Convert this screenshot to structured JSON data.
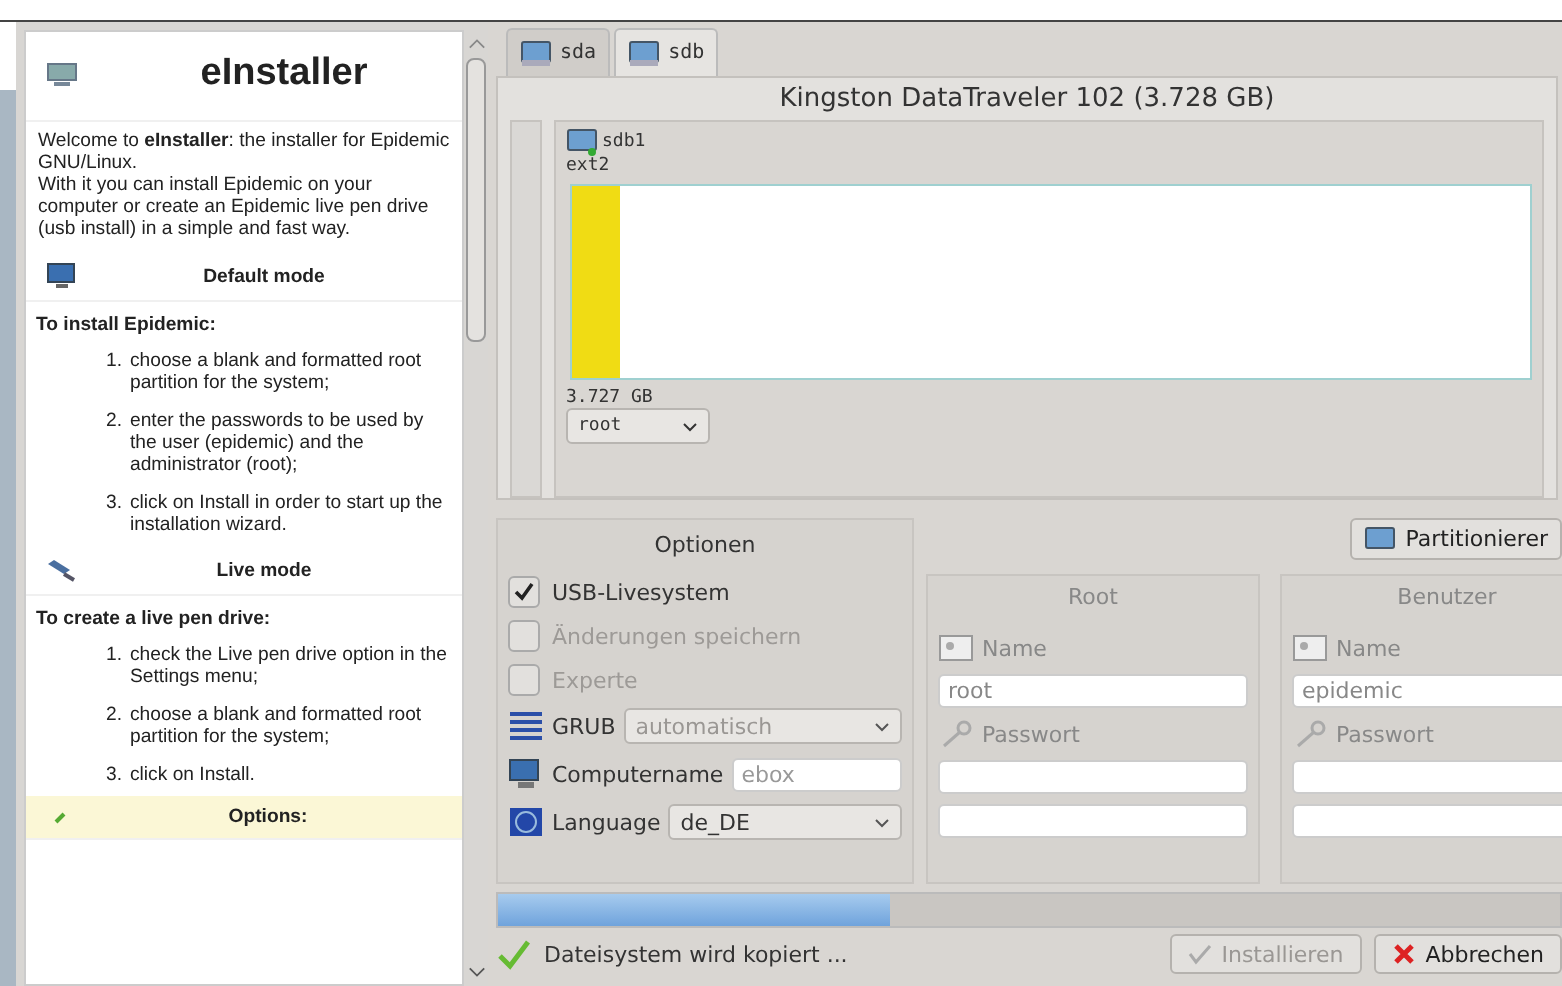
{
  "help": {
    "title": "eInstaller",
    "intro": "Welcome to **eInstaller**: the installer for Epidemic GNU/Linux.\nWith it you can install Epidemic on your computer or create an Epidemic live pen drive (usb install) in a simple and fast way.",
    "sections": [
      {
        "kind": "default",
        "heading": "Default mode",
        "subheading": "To install Epidemic:",
        "steps": [
          {
            "number": "1.",
            "text": "choose a blank and formatted root partition for the system;"
          },
          {
            "number": "2.",
            "text": "enter the passwords to be used by the user (epidemic) and the administrator (root);"
          },
          {
            "number": "3.",
            "text": "click on Install in order to start up the installation wizard."
          }
        ]
      },
      {
        "kind": "live",
        "heading": "Live mode",
        "subheading": "To create a live pen drive:",
        "steps": [
          {
            "number": "1.",
            "text": "check the Live pen drive option in the Settings menu;"
          },
          {
            "number": "2.",
            "text": "choose a blank and formatted root partition for the system;"
          },
          {
            "number": "3.",
            "text": "click on Install."
          }
        ]
      },
      {
        "kind": "options",
        "heading": "Options:"
      }
    ]
  },
  "tabs": [
    {
      "label": "sda",
      "selected": false
    },
    {
      "label": "sdb",
      "selected": true
    }
  ],
  "drive": {
    "title": "Kingston DataTraveler 102 (3.728 GB)",
    "partition": {
      "name": "sdb1",
      "filesystem": "ext2",
      "level": 0.05,
      "size": "3.727 GB",
      "mount": "root"
    }
  },
  "options": {
    "title": "Optionen",
    "checkboxes": [
      {
        "label": "USB-Livesystem",
        "checked": true,
        "disabled": false
      },
      {
        "label": "Änderungen speichern",
        "checked": false,
        "disabled": true
      },
      {
        "label": "Experte",
        "checked": false,
        "disabled": true
      }
    ],
    "fields": [
      {
        "kind": "select",
        "label": "GRUB",
        "value": "automatisch",
        "disabled": true
      },
      {
        "kind": "input",
        "label": "Computername",
        "placeholder": "ebox",
        "disabled": false
      },
      {
        "kind": "select",
        "label": "Language",
        "value": "de_DE",
        "disabled": false
      }
    ]
  },
  "partitioner_button": "Partitionierer",
  "accounts": [
    {
      "title": "Root",
      "name_label": "Name",
      "name": "root",
      "password_label": "Passwort"
    },
    {
      "title": "Benutzer",
      "name_label": "Name",
      "name": "epidemic",
      "password_label": "Passwort"
    }
  ],
  "progress": {
    "level": 0.37
  },
  "status": "Dateisystem wird kopiert ...",
  "buttons": [
    {
      "label": "Installieren",
      "kind": "install",
      "disabled": true
    },
    {
      "label": "Abbrechen",
      "kind": "cancel",
      "disabled": false
    }
  ]
}
